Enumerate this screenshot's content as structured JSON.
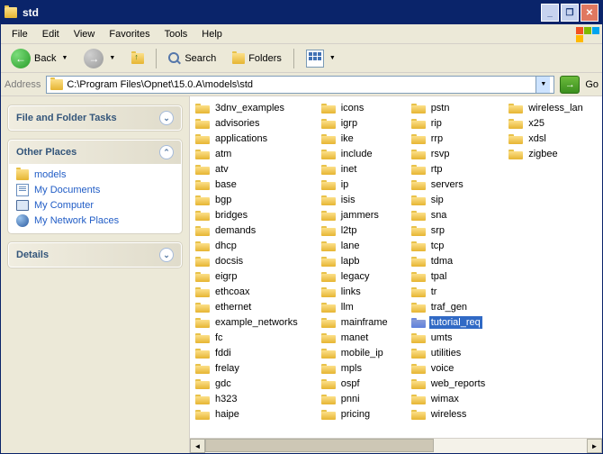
{
  "window": {
    "title": "std"
  },
  "menu": {
    "items": [
      "File",
      "Edit",
      "View",
      "Favorites",
      "Tools",
      "Help"
    ]
  },
  "toolbar": {
    "back": "Back",
    "search": "Search",
    "folders": "Folders"
  },
  "addressbar": {
    "label": "Address",
    "path": "C:\\Program Files\\Opnet\\15.0.A\\models\\std",
    "go": "Go"
  },
  "sidebar": {
    "tasks_title": "File and Folder Tasks",
    "places_title": "Other Places",
    "details_title": "Details",
    "places": [
      {
        "icon": "folder",
        "label": "models"
      },
      {
        "icon": "doc",
        "label": "My Documents"
      },
      {
        "icon": "comp",
        "label": "My Computer"
      },
      {
        "icon": "net",
        "label": "My Network Places"
      }
    ]
  },
  "selected": "tutorial_req",
  "files": [
    "3dnv_examples",
    "advisories",
    "applications",
    "atm",
    "atv",
    "base",
    "bgp",
    "bridges",
    "demands",
    "dhcp",
    "docsis",
    "eigrp",
    "ethcoax",
    "ethernet",
    "example_networks",
    "fc",
    "fddi",
    "frelay",
    "gdc",
    "h323",
    "haipe",
    "icons",
    "igrp",
    "ike",
    "include",
    "inet",
    "ip",
    "isis",
    "jammers",
    "l2tp",
    "lane",
    "lapb",
    "legacy",
    "links",
    "llm",
    "mainframe",
    "manet",
    "mobile_ip",
    "mpls",
    "ospf",
    "pnni",
    "pricing",
    "pstn",
    "rip",
    "rrp",
    "rsvp",
    "rtp",
    "servers",
    "sip",
    "sna",
    "srp",
    "tcp",
    "tdma",
    "tpal",
    "tr",
    "traf_gen",
    "tutorial_req",
    "umts",
    "utilities",
    "voice",
    "web_reports",
    "wimax",
    "wireless",
    "wireless_lan",
    "x25",
    "xdsl",
    "zigbee"
  ]
}
